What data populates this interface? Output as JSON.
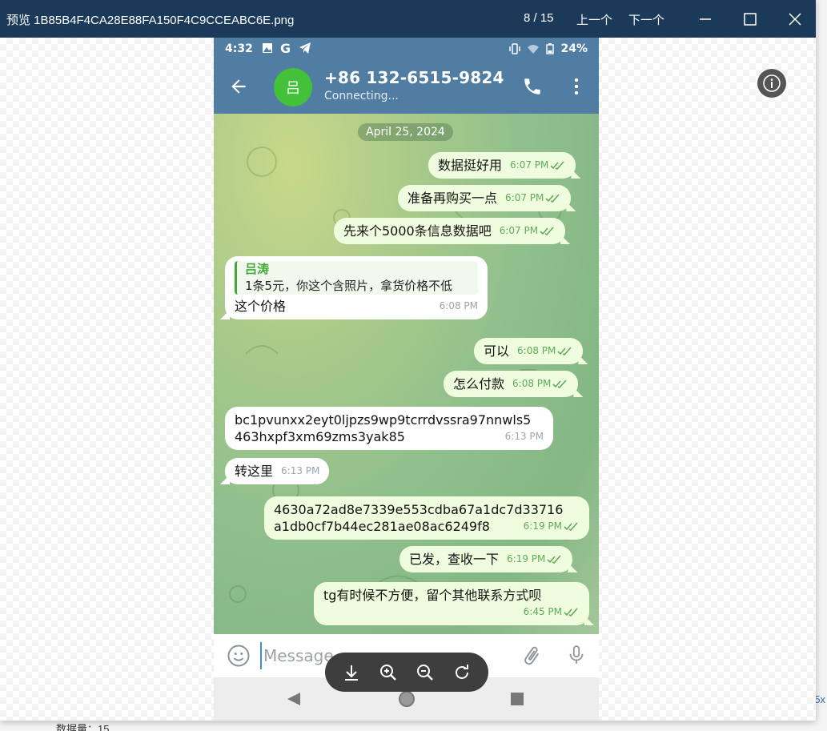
{
  "window": {
    "title": "预览 1B85B4F4CA28E88FA150F4C9CCEABC6E.png",
    "pager": "8 / 15",
    "prev_label": "上一个",
    "next_label": "下一个"
  },
  "desktop": {
    "bottom_text": "数据量：15",
    "side_text": "5x"
  },
  "phone": {
    "status_time": "4:32",
    "battery": "24%",
    "contact_name": "+86 132-6515-9824",
    "contact_status": "Connecting...",
    "avatar_letter": "吕",
    "date_label": "April 25, 2024",
    "composer_placeholder": "Message"
  },
  "messages": [
    {
      "dir": "out",
      "text": "数据挺好用",
      "time": "6:07 PM"
    },
    {
      "dir": "out",
      "text": "准备再购买一点",
      "time": "6:07 PM"
    },
    {
      "dir": "out",
      "text": "先来个5000条信息数据吧",
      "time": "6:07 PM"
    },
    {
      "dir": "in",
      "reply_name": "吕涛",
      "reply_text": "1条5元，你这个含照片，拿货价格不低",
      "text": "这个价格",
      "time": "6:08 PM"
    },
    {
      "dir": "out",
      "text": "可以",
      "time": "6:08 PM"
    },
    {
      "dir": "out",
      "text": "怎么付款",
      "time": "6:08 PM"
    },
    {
      "dir": "in",
      "line1": "bc1pvunxx2eyt0ljpzs9wp9tcrrdvssra97nnwls5",
      "line2": "463hxpf3xm69zms3yak85",
      "time": "6:13 PM"
    },
    {
      "dir": "in",
      "text": "转这里",
      "time": "6:13 PM"
    },
    {
      "dir": "out",
      "line1": "4630a72ad8e7339e553cdba67a1dc7d33716",
      "line2": "a1db0cf7b44ec281ae08ac6249f8",
      "time": "6:19 PM"
    },
    {
      "dir": "out",
      "text": "已发，查收一下",
      "time": "6:19 PM"
    },
    {
      "dir": "out",
      "text": "tg有时候不方便，留个其他联系方式呗",
      "time": "6:45 PM"
    }
  ]
}
